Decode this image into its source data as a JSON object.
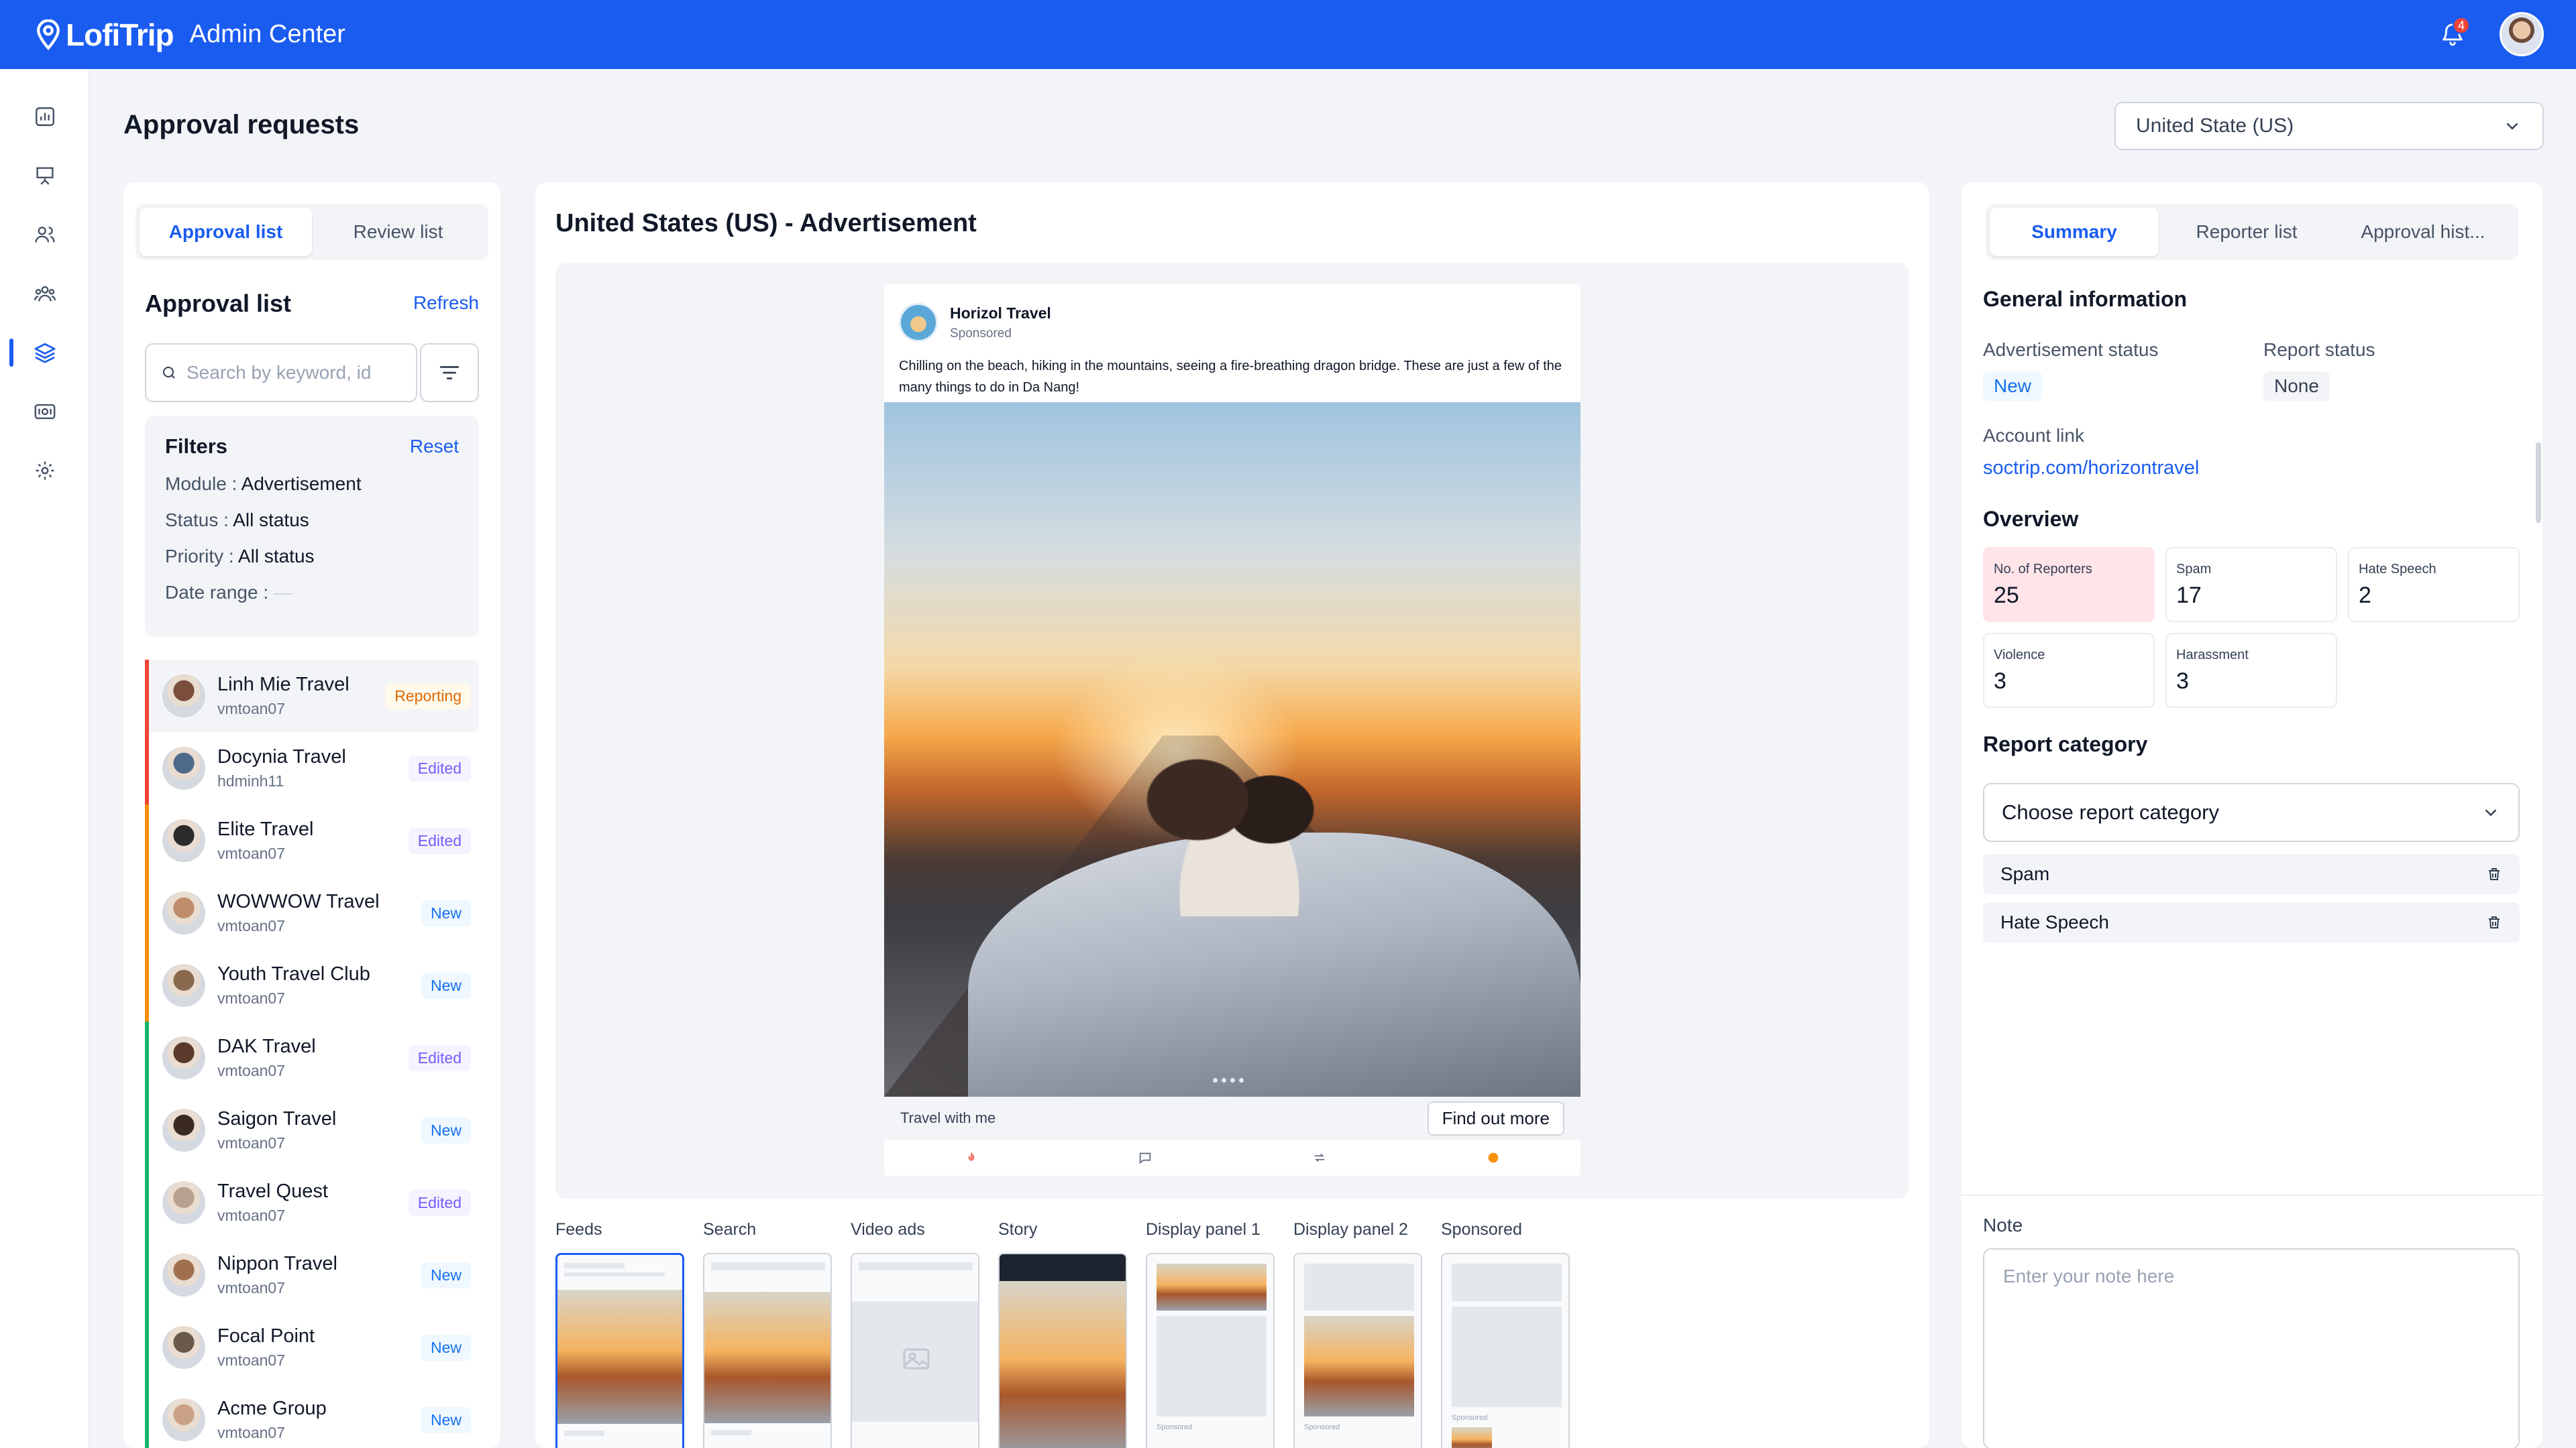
{
  "app": {
    "brand": "LofiTrip",
    "title": "Admin Center",
    "notifications": "4"
  },
  "page": {
    "title": "Approval requests"
  },
  "country_select": {
    "value": "United State (US)"
  },
  "left": {
    "tabs": [
      "Approval list",
      "Review list"
    ],
    "title": "Approval list",
    "refresh": "Refresh",
    "search_placeholder": "Search by keyword, id",
    "filters": {
      "title": "Filters",
      "reset": "Reset",
      "rows": [
        {
          "label": "Module :",
          "value": "Advertisement"
        },
        {
          "label": "Status :",
          "value": "All status"
        },
        {
          "label": "Priority :",
          "value": "All status"
        },
        {
          "label": "Date range :",
          "value": "—"
        }
      ]
    },
    "items": [
      {
        "name": "Linh Mie Travel",
        "user": "vmtoan07",
        "status": "Reporting",
        "bar": "#f04438"
      },
      {
        "name": "Docynia Travel",
        "user": "hdminh11",
        "status": "Edited",
        "bar": "#f04438"
      },
      {
        "name": "Elite Travel",
        "user": "vmtoan07",
        "status": "Edited",
        "bar": "#f79009"
      },
      {
        "name": "WOWWOW Travel",
        "user": "vmtoan07",
        "status": "New",
        "bar": "#f79009"
      },
      {
        "name": "Youth Travel Club",
        "user": "vmtoan07",
        "status": "New",
        "bar": "#f79009"
      },
      {
        "name": "DAK Travel",
        "user": "vmtoan07",
        "status": "Edited",
        "bar": "#12b76a"
      },
      {
        "name": "Saigon Travel",
        "user": "vmtoan07",
        "status": "New",
        "bar": "#12b76a"
      },
      {
        "name": "Travel Quest",
        "user": "vmtoan07",
        "status": "Edited",
        "bar": "#12b76a"
      },
      {
        "name": "Nippon Travel",
        "user": "vmtoan07",
        "status": "New",
        "bar": "#12b76a"
      },
      {
        "name": "Focal Point",
        "user": "vmtoan07",
        "status": "New",
        "bar": "#12b76a"
      },
      {
        "name": "Acme Group",
        "user": "vmtoan07",
        "status": "New",
        "bar": "#12b76a"
      }
    ]
  },
  "center": {
    "title": "United States (US) - Advertisement",
    "post": {
      "name": "Horizol Travel",
      "sponsored": "Sponsored",
      "text": "Chilling on the beach, hiking in the mountains, seeing a fire-breathing dragon bridge. These are just a few of the many things to do in Da Nang!",
      "caption": "Travel with me",
      "cta": "Find out more"
    },
    "placements": [
      "Feeds",
      "Search",
      "Video ads",
      "Story",
      "Display panel 1",
      "Display panel 2",
      "Sponsored"
    ],
    "thumb_sponsored": "Sponsored"
  },
  "right": {
    "tabs": [
      "Summary",
      "Reporter list",
      "Approval hist..."
    ],
    "general_title": "General information",
    "ad_status_label": "Advertisement status",
    "ad_status": "New",
    "report_status_label": "Report status",
    "report_status": "None",
    "account_label": "Account link",
    "account_link": "soctrip.com/horizontravel",
    "overview_title": "Overview",
    "overview": [
      {
        "label": "No. of Reporters",
        "value": "25"
      },
      {
        "label": "Spam",
        "value": "17"
      },
      {
        "label": "Hate Speech",
        "value": "2"
      },
      {
        "label": "Violence",
        "value": "3"
      },
      {
        "label": "Harassment",
        "value": "3"
      }
    ],
    "category_title": "Report category",
    "category_placeholder": "Choose report category",
    "categories": [
      "Spam",
      "Hate Speech"
    ],
    "note_label": "Note",
    "note_placeholder": "Enter your note here"
  },
  "colors": {
    "primary": "#1a5cf0",
    "reporting": "#dc6803",
    "edited": "#7a5af8",
    "new": "#1570ef"
  }
}
